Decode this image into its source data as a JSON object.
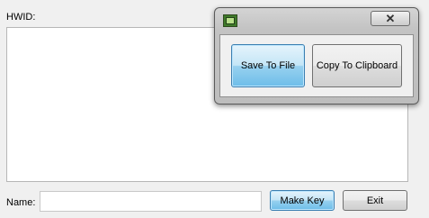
{
  "main": {
    "hwid_label": "HWID:",
    "hwid_value": "",
    "name_label": "Name:",
    "name_value": "",
    "make_key_label": "Make Key",
    "exit_label": "Exit"
  },
  "popup": {
    "title": "",
    "icon": "app-icon",
    "close_glyph": "✕",
    "save_label": "Save To File",
    "copy_label": "Copy To Clipboard"
  },
  "colors": {
    "window_bg": "#f0f0f0",
    "default_button": "#98d1ef"
  }
}
